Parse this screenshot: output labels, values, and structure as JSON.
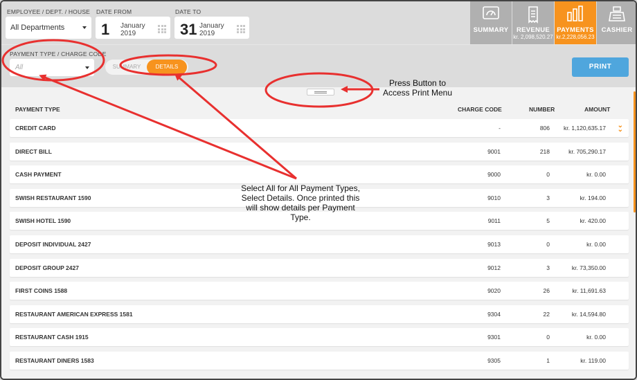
{
  "filters": {
    "employee_label": "EMPLOYEE / DEPT. / HOUSE",
    "employee_value": "All Departments",
    "date_from_label": "DATE FROM",
    "date_from_day": "1",
    "date_from_month": "January",
    "date_from_year": "2019",
    "date_to_label": "DATE TO",
    "date_to_day": "31",
    "date_to_month": "January",
    "date_to_year": "2019",
    "payment_type_label": "PAYMENT TYPE / CHARGE CODE",
    "payment_type_placeholder": "All"
  },
  "tabs": [
    {
      "label": "SUMMARY",
      "sub": "",
      "icon": "gauge-icon",
      "active": false
    },
    {
      "label": "REVENUE",
      "sub": "kr. 2,098,520.27",
      "icon": "receipt-icon",
      "active": false
    },
    {
      "label": "PAYMENTS",
      "sub": "kr.2,228,056.23",
      "icon": "bar-chart-icon",
      "active": true
    },
    {
      "label": "CASHIER",
      "sub": "",
      "icon": "cash-register-icon",
      "active": false
    }
  ],
  "toggle": {
    "summary": "SUMMARY",
    "details": "DETAILS",
    "selected": "DETAILS"
  },
  "print_label": "PRINT",
  "table": {
    "headers": {
      "payment_type": "PAYMENT TYPE",
      "charge_code": "CHARGE CODE",
      "number": "NUMBER",
      "amount": "AMOUNT"
    },
    "rows": [
      {
        "name": "CREDIT CARD",
        "code": "-",
        "number": "806",
        "amount": "kr. 1,120,635.17"
      },
      {
        "name": "DIRECT BILL",
        "code": "9001",
        "number": "218",
        "amount": "kr. 705,290.17"
      },
      {
        "name": "CASH PAYMENT",
        "code": "9000",
        "number": "0",
        "amount": "kr. 0.00"
      },
      {
        "name": "SWISH RESTAURANT 1590",
        "code": "9010",
        "number": "3",
        "amount": "kr. 194.00"
      },
      {
        "name": "SWISH HOTEL 1590",
        "code": "9011",
        "number": "5",
        "amount": "kr. 420.00"
      },
      {
        "name": "DEPOSIT INDIVIDUAL 2427",
        "code": "9013",
        "number": "0",
        "amount": "kr. 0.00"
      },
      {
        "name": "DEPOSIT GROUP 2427",
        "code": "9012",
        "number": "3",
        "amount": "kr. 73,350.00"
      },
      {
        "name": "FIRST COINS 1588",
        "code": "9020",
        "number": "26",
        "amount": "kr. 11,691.63"
      },
      {
        "name": "RESTAURANT AMERICAN EXPRESS 1581",
        "code": "9304",
        "number": "22",
        "amount": "kr. 14,594.80"
      },
      {
        "name": "RESTAURANT CASH 1915",
        "code": "9301",
        "number": "0",
        "amount": "kr. 0.00"
      },
      {
        "name": "RESTAURANT DINERS 1583",
        "code": "9305",
        "number": "1",
        "amount": "kr. 119.00"
      }
    ]
  },
  "annotations": {
    "print_note": "Press Button to Access Print Menu",
    "details_note": "Select All for All Payment Types, Select Details.  Once printed this will show details per Payment Type."
  },
  "colors": {
    "accent": "#f7931e",
    "print_button": "#4fa6dd",
    "annotation": "#e8302f"
  }
}
